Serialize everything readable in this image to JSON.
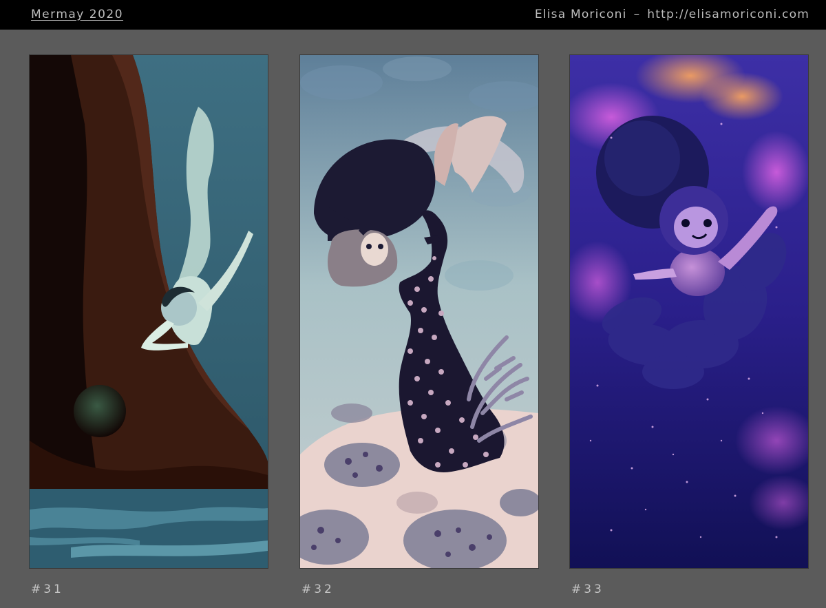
{
  "header": {
    "title": "Mermay 2020",
    "author": "Elisa Moriconi",
    "separator": "–",
    "url": "http://elisamoriconi.com"
  },
  "artworks": [
    {
      "caption": "#31",
      "subject": "mermaid diving beside tree trunk",
      "palette": [
        "#1a0c08",
        "#3a1f12",
        "#2c5a6a",
        "#4a8294",
        "#cfe3d8"
      ]
    },
    {
      "caption": "#32",
      "subject": "mermaid with spotted sea creature",
      "palette": [
        "#6d8fa4",
        "#a8c2c7",
        "#e9d2cc",
        "#1c1830",
        "#8a7a9a"
      ]
    },
    {
      "caption": "#33",
      "subject": "mermaid floating in cosmic bokeh",
      "palette": [
        "#1a1a6e",
        "#3b2fa8",
        "#b25ad8",
        "#f0a060",
        "#101040"
      ]
    }
  ]
}
